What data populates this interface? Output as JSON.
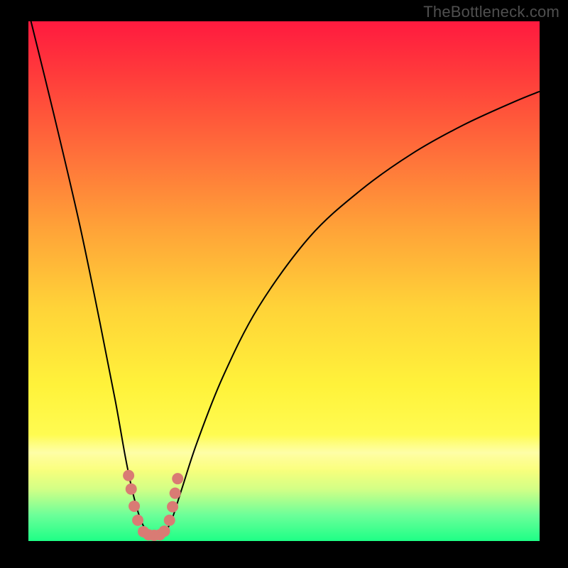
{
  "watermark": "TheBottleneck.com",
  "colors": {
    "frame": "#000000",
    "marker": "#d97b74",
    "curve": "#000000"
  },
  "chart_data": {
    "type": "line",
    "title": "",
    "xlabel": "",
    "ylabel": "",
    "xlim_percent": [
      0,
      100
    ],
    "ylim_percent": [
      0,
      100
    ],
    "note": "Axes are implied (no tick labels visible). Values below are approximate relative coordinates as percent of plot area (x from left, y = curve height as percent from bottom). The curve depicts bottleneck magnitude approaching 0 near x≈21–27% then rising again toward the right.",
    "x": [
      0,
      5,
      10,
      14,
      17,
      19,
      20.5,
      22,
      23.5,
      25,
      26.5,
      28,
      30,
      33,
      38,
      45,
      55,
      65,
      75,
      85,
      95,
      100
    ],
    "values": [
      102,
      82,
      61,
      42,
      27,
      16,
      9,
      4,
      1.5,
      1,
      1.5,
      4,
      10,
      19,
      31.5,
      45,
      58.5,
      67.5,
      74.5,
      80,
      84.5,
      86.5
    ],
    "markers": {
      "description": "Salmon-colored marker dots near the trough indicating near-zero bottleneck region",
      "points_percent_from_left_bottom": [
        [
          19.6,
          12.6
        ],
        [
          20.1,
          10.0
        ],
        [
          20.7,
          6.7
        ],
        [
          21.4,
          4.0
        ],
        [
          22.5,
          1.8
        ],
        [
          23.5,
          1.2
        ],
        [
          24.6,
          1.1
        ],
        [
          25.7,
          1.2
        ],
        [
          26.6,
          1.9
        ],
        [
          27.6,
          4.0
        ],
        [
          28.2,
          6.6
        ],
        [
          28.7,
          9.2
        ],
        [
          29.2,
          12.0
        ]
      ]
    }
  }
}
